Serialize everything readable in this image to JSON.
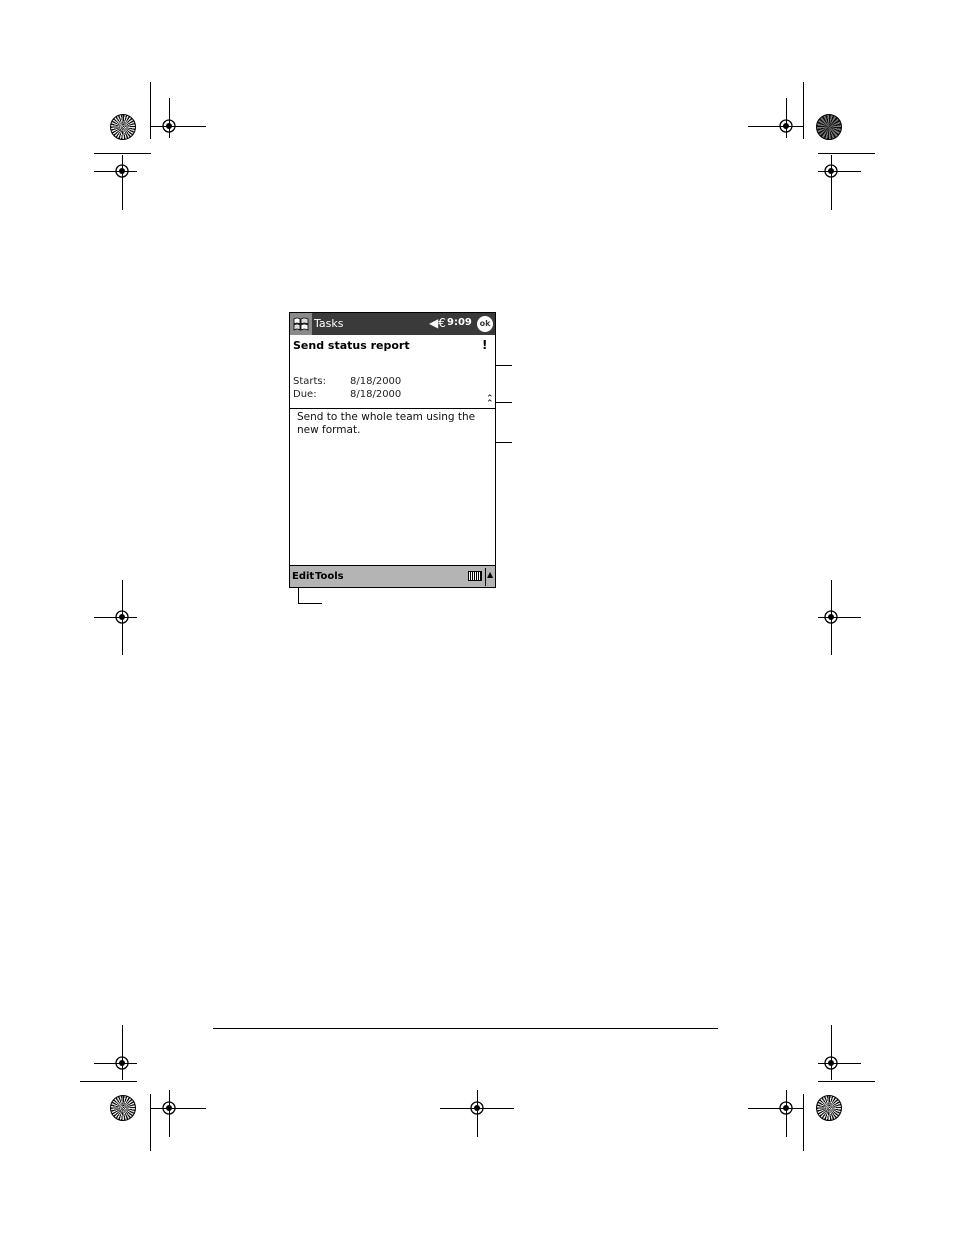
{
  "titlebar": {
    "app_title": "Tasks",
    "start_icon": "windows-flag-icon",
    "volume_glyph": "◀€",
    "time": "9:09",
    "ok_label": "ok"
  },
  "task": {
    "subject": "Send status report",
    "priority_marker": "!",
    "starts_label": "Starts:",
    "starts_value": "8/18/2000",
    "due_label": "Due:",
    "due_value": "8/18/2000",
    "collapse_glyph": "⌃",
    "notes": "Send to the whole team using the new format."
  },
  "menubar": {
    "edit_label": "Edit",
    "tools_label": "Tools",
    "sip_arrow": "▲"
  },
  "colors": {
    "titlebar": "#3a3a3a",
    "menubar": "#b4b4b4"
  }
}
